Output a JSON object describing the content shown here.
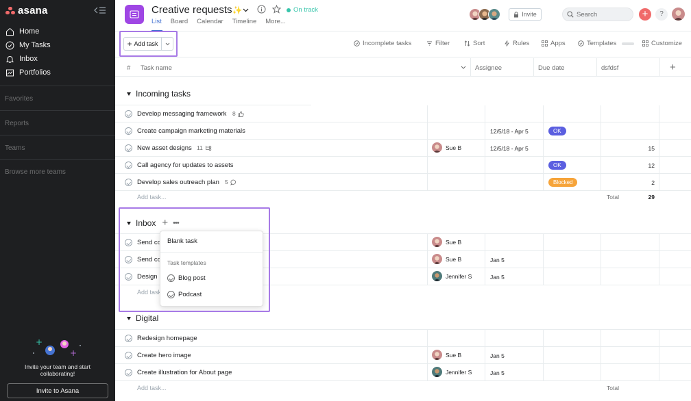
{
  "app": {
    "name": "asana"
  },
  "sidebar": {
    "items": [
      {
        "label": "Home",
        "icon": "home-icon"
      },
      {
        "label": "My Tasks",
        "icon": "check-circle-icon"
      },
      {
        "label": "Inbox",
        "icon": "bell-icon"
      },
      {
        "label": "Portfolios",
        "icon": "chart-icon"
      }
    ],
    "sections": [
      "Favorites",
      "Reports",
      "Teams",
      "Browse more teams"
    ],
    "invite_text": "Invite your team and start collaborating!",
    "invite_button": "Invite to Asana"
  },
  "header": {
    "project_title": "Creative requests",
    "sparkle": "✨",
    "status": "On track",
    "tabs": [
      "List",
      "Board",
      "Calendar",
      "Timeline",
      "More..."
    ],
    "invite_label": "Invite",
    "search_placeholder": "Search",
    "help_label": "?"
  },
  "toolbar": {
    "add_task": "Add task",
    "incomplete_tasks": "Incomplete tasks",
    "filter": "Filter",
    "sort": "Sort",
    "rules": "Rules",
    "apps": "Apps",
    "templates": "Templates",
    "customize": "Customize"
  },
  "columns": {
    "number": "#",
    "task_name": "Task name",
    "assignee": "Assignee",
    "due_date": "Due date",
    "custom": "dsfdsf",
    "add": "+"
  },
  "sections": [
    {
      "title": "Incoming tasks",
      "tasks": [
        {
          "name": "Develop messaging framework",
          "meta": "8",
          "meta_icon": "thumbs-up-icon"
        },
        {
          "name": "Create campaign marketing materials",
          "due": "12/5/18 - Apr 5",
          "badge": "OK"
        },
        {
          "name": "New asset designs",
          "meta": "11",
          "meta_icon": "subtask-icon",
          "assignee": "Sue B",
          "due": "12/5/18 - Apr 5",
          "number": "15"
        },
        {
          "name": "Call agency for updates to assets",
          "badge": "OK",
          "number": "12"
        },
        {
          "name": "Develop sales outreach plan",
          "meta": "5",
          "meta_icon": "comment-icon",
          "badge": "Blocked",
          "number": "2"
        }
      ],
      "add_task": "Add task...",
      "total_label": "Total",
      "total_value": "29"
    },
    {
      "title": "Inbox",
      "tasks": [
        {
          "name": "Send co",
          "assignee": "Sue B"
        },
        {
          "name": "Send co",
          "assignee": "Sue B",
          "due": "Jan 5"
        },
        {
          "name": "Design",
          "assignee": "Jennifer S",
          "due": "Jan 5"
        }
      ],
      "add_task": "Add task"
    },
    {
      "title": "Digital",
      "tasks": [
        {
          "name": "Redesign homepage"
        },
        {
          "name": "Create hero image",
          "assignee": "Sue B",
          "due": "Jan 5"
        },
        {
          "name": "Create illustration for About page",
          "assignee": "Jennifer S",
          "due": "Jan 5"
        }
      ],
      "add_task": "Add task...",
      "total_label": "Total"
    }
  ],
  "dropdown": {
    "blank_task": "Blank task",
    "templates_label": "Task templates",
    "templates": [
      "Blog post",
      "Podcast"
    ]
  },
  "colors": {
    "sidebar_bg": "#1e1f21",
    "accent": "#4573d2",
    "ok_badge": "#5b5fe0",
    "blocked_badge": "#f6a43a",
    "on_track": "#37c5ab",
    "project_icon": "#9f46e4",
    "highlight": "#a77ae6"
  }
}
